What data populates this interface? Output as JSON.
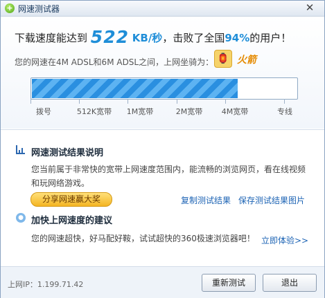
{
  "window": {
    "title": "网速测试器",
    "close_glyph": "✕",
    "logo_glyph": "+"
  },
  "result": {
    "headline_prefix": "下载速度能达到",
    "speed_value": "522",
    "speed_unit": "KB/秒",
    "headline_middle": "，击败了全国",
    "percent": "94%",
    "headline_suffix": "的用户！",
    "range_text": "您的网速在4M ADSL和6M ADSL之间，上网坐骑为：",
    "mount_icon": "lantern-icon",
    "mount_glyph": "🏮",
    "mount_name": "火箭",
    "progress_fraction": 0.777
  },
  "scale": {
    "labels": [
      "拨号",
      "512K宽带",
      "1M宽带",
      "2M宽带",
      "4M宽带",
      "专线"
    ]
  },
  "explanation": {
    "title": "网速测试结果说明",
    "text": "您当前属于非常快的宽带上网速度范围内，能流畅的浏览网页，看在线视频和玩网络游戏。",
    "share_label": "分享网速赢大奖",
    "copy_label": "复制测试结果",
    "save_label": "保存测试结果图片"
  },
  "advice": {
    "title": "加快上网速度的建议",
    "text": "您的网速超快，好马配好鞍，试试超快的360极速浏览器吧！",
    "try_label": "立即体验>>"
  },
  "footer": {
    "ip_text": "上网IP：1.199.71.42",
    "retest_label": "重新测试",
    "exit_label": "退出"
  },
  "colors": {
    "accent": "#1f8ed8",
    "link": "#1c63b4",
    "mount": "#e58a00"
  }
}
